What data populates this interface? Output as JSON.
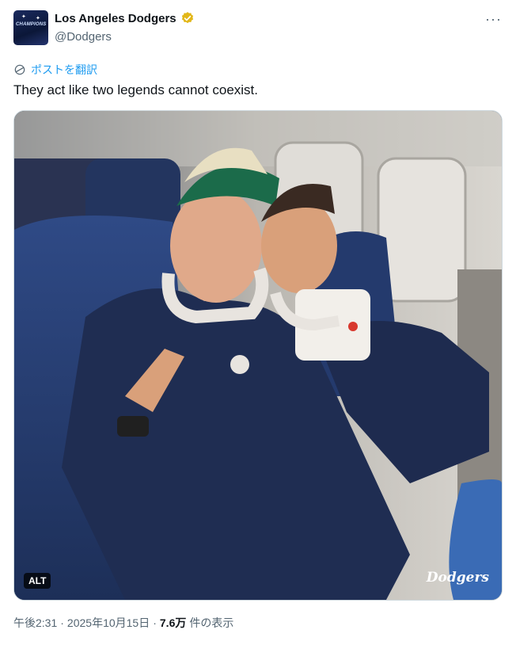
{
  "author": {
    "display_name": "Los Angeles Dodgers",
    "handle": "@Dodgers",
    "avatar_icon": "champions-logo",
    "verified_icon": "gold-check-badge",
    "verified_color": "#e2b719"
  },
  "actions": {
    "more_icon": "more-dots-icon",
    "more_label": "···"
  },
  "translate": {
    "label": "ポストを翻訳",
    "icon": "globe-icon"
  },
  "post": {
    "text": "They act like two legends cannot coexist."
  },
  "media": {
    "alt_badge": "ALT",
    "brand_mark": "Dodgers"
  },
  "meta": {
    "time": "午後2:31",
    "sep1": "·",
    "date": "2025年10月15日",
    "sep2": "·",
    "views_count": "7.6万",
    "views_label": "件の表示"
  },
  "colors": {
    "accent": "#1d9bf0",
    "text": "#0f1419",
    "muted": "#536471"
  }
}
